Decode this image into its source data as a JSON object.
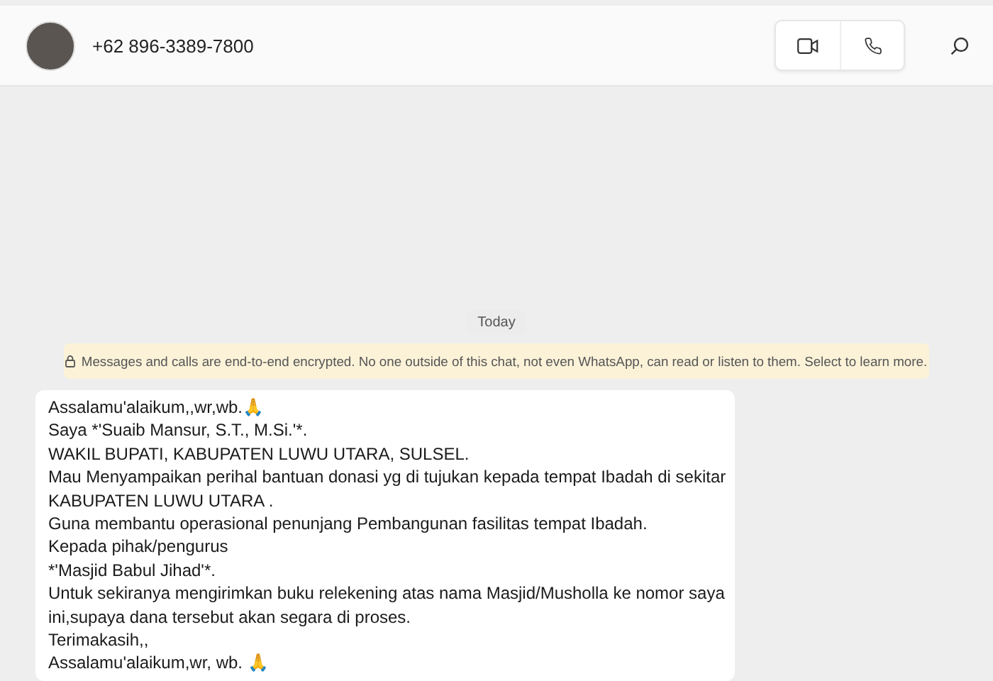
{
  "header": {
    "contact": "+62 896-3389-7800"
  },
  "chat": {
    "date_label": "Today",
    "encryption_notice": "Messages and calls are end-to-end encrypted. No one outside of this chat, not even WhatsApp, can read or listen to them. Select to learn more.",
    "message_lines": [
      "Assalamu'alaikum,,wr,wb.🙏",
      "Saya *'Suaib Mansur, S.T., M.Si.'*.",
      "WAKIL BUPATI, KABUPATEN LUWU UTARA, SULSEL.",
      "Mau Menyampaikan perihal bantuan donasi yg di tujukan kepada tempat Ibadah di sekitar",
      "KABUPATEN LUWU UTARA .",
      "Guna membantu operasional penunjang Pembangunan fasilitas tempat Ibadah.",
      "Kepada pihak/pengurus",
      "*'Masjid Babul Jihad'*.",
      "Untuk sekiranya mengirimkan buku relekening atas nama Masjid/Musholla ke nomor saya",
      "ini,supaya dana tersebut akan segara di proses.",
      "Terimakasih,,",
      "Assalamu'alaikum,wr, wb. 🙏"
    ]
  }
}
